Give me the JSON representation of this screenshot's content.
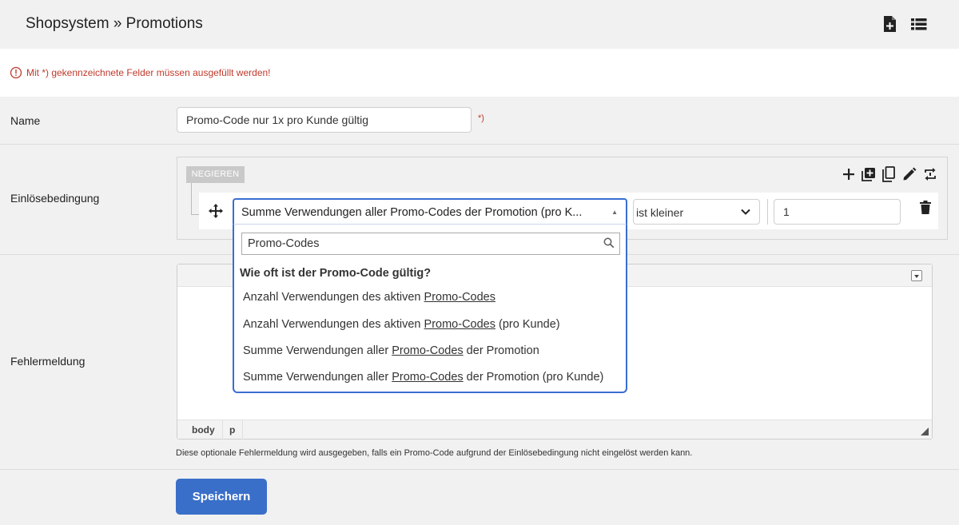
{
  "header": {
    "title": "Shopsystem » Promotions",
    "icons": [
      "new-document-icon",
      "list-icon"
    ]
  },
  "notice": {
    "text": "Mit *) gekennzeichnete Felder müssen ausgefüllt werden!",
    "color": "#c0392b"
  },
  "fields": {
    "name": {
      "label": "Name",
      "value": "Promo-Code nur 1x pro Kunde gültig",
      "required_marker": "*)"
    },
    "condition": {
      "label": "Einlösebedingung",
      "negate_label": "NEGIEREN",
      "tools": [
        "plus-icon",
        "add-group-icon",
        "copy-icon",
        "edit-icon",
        "swap-icon"
      ],
      "selected": "Summe Verwendungen aller Promo-Codes der Promotion (pro K...",
      "operator": "ist kleiner",
      "value": "1",
      "dropdown": {
        "search_value": "Promo-Codes",
        "group_label": "Wie oft ist der Promo-Code gültig?",
        "options": [
          {
            "before": "Anzahl Verwendungen des aktiven ",
            "match": "Promo-Codes",
            "after": ""
          },
          {
            "before": "Anzahl Verwendungen des aktiven ",
            "match": "Promo-Codes",
            "after": " (pro Kunde)"
          },
          {
            "before": "Summe Verwendungen aller ",
            "match": "Promo-Codes",
            "after": " der Promotion"
          },
          {
            "before": "Summe Verwendungen aller ",
            "match": "Promo-Codes",
            "after": " der Promotion (pro Kunde)"
          }
        ]
      }
    },
    "error_message": {
      "label": "Fehlermeldung",
      "path": [
        "body",
        "p"
      ],
      "hint": "Diese optionale Fehlermeldung wird ausgegeben, falls ein Promo-Code aufgrund der Einlösebedingung nicht eingelöst werden kann."
    }
  },
  "actions": {
    "save_label": "Speichern"
  },
  "colors": {
    "accent": "#3a6ed1",
    "button": "#3a6fc9",
    "background": "#f1f1f1"
  }
}
